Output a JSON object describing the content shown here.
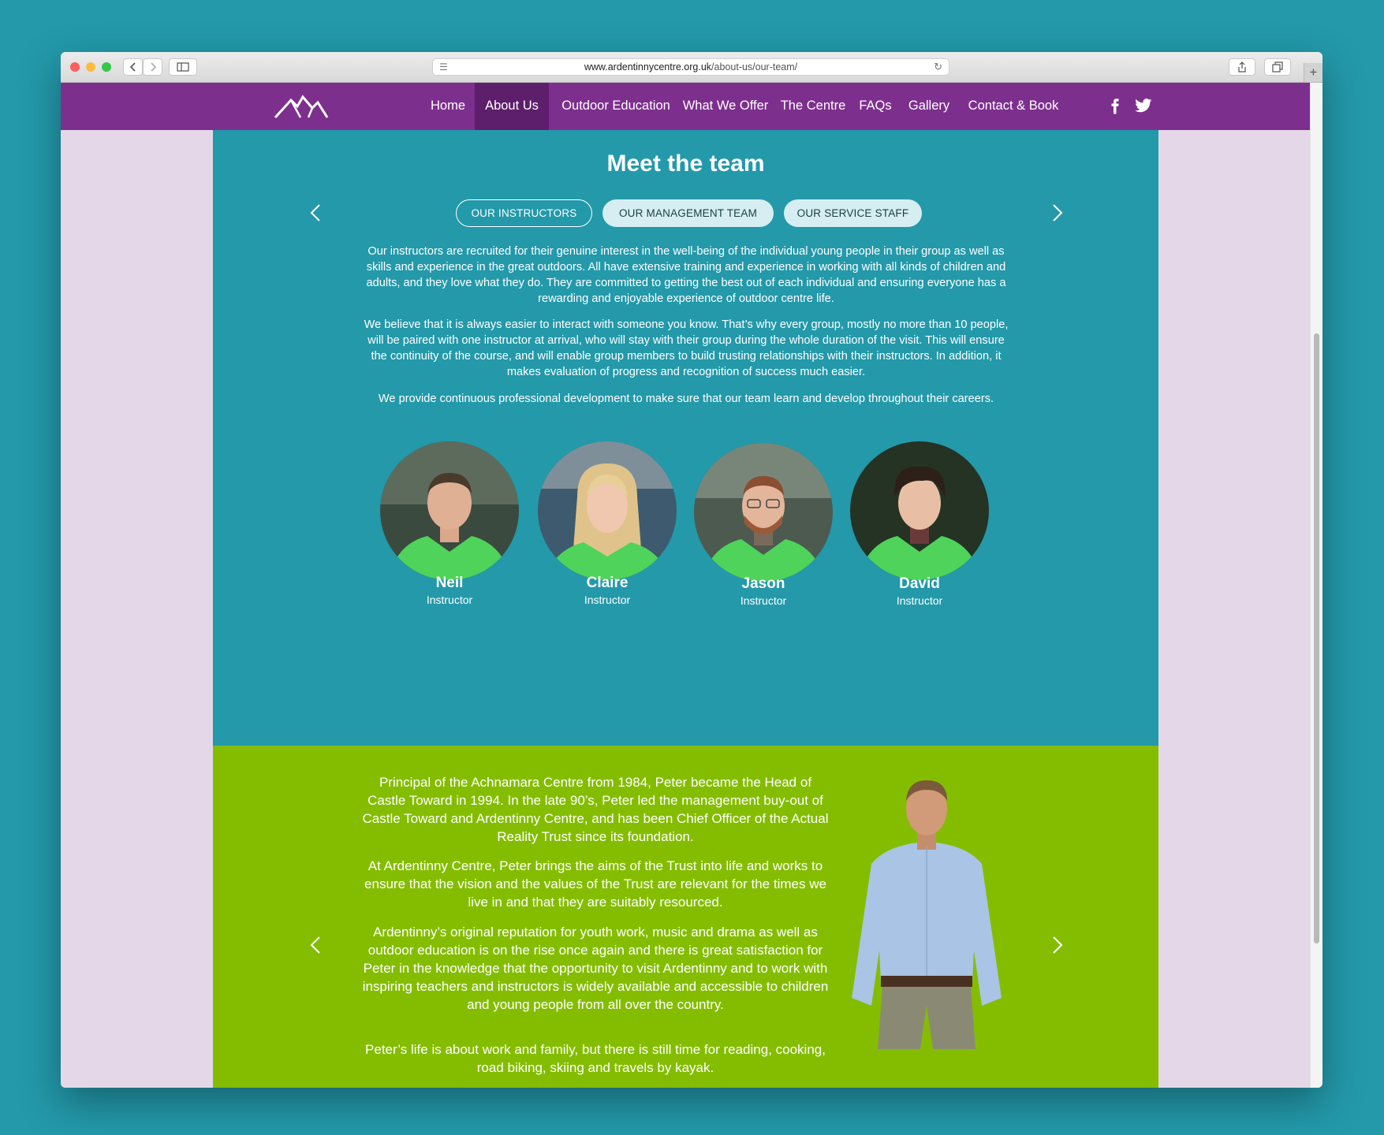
{
  "browser": {
    "url_domain": "www.ardentinnycentre.org.uk",
    "url_path": "/about-us/our-team/"
  },
  "nav": {
    "items": [
      "Home",
      "About Us",
      "Outdoor Education",
      "What We Offer",
      "The Centre",
      "FAQs",
      "Gallery",
      "Contact & Book"
    ],
    "active": "About Us",
    "social": [
      "facebook-icon",
      "twitter-icon"
    ]
  },
  "team": {
    "title": "Meet the team",
    "tabs": [
      "OUR INSTRUCTORS",
      "OUR MANAGEMENT TEAM",
      "OUR SERVICE STAFF"
    ],
    "paragraphs": [
      "Our instructors are recruited for their genuine interest in the well-being of the individual young people in their group as well as skills and experience in the great outdoors. All have extensive training and experience in working with all kinds of children and adults, and they love what they do. They are committed to getting the best out of each individual and ensuring everyone has a rewarding and enjoyable experience of outdoor centre life.",
      "We believe that it is always easier to interact with someone you know. That’s why every group, mostly no more than 10 people, will be paired with one instructor at arrival, who will stay with their group during the whole duration of the visit. This will ensure the continuity of the course, and will enable group members to build trusting relationships with their instructors. In addition, it makes evaluation of progress and recognition of success much easier.",
      "We provide continuous professional development to make sure that our team learn and develop throughout their careers."
    ],
    "members": [
      {
        "name": "Neil",
        "role": "Instructor"
      },
      {
        "name": "Claire",
        "role": "Instructor"
      },
      {
        "name": "Jason",
        "role": "Instructor"
      },
      {
        "name": "David",
        "role": "Instructor"
      }
    ]
  },
  "profile": {
    "paragraphs": [
      "Principal of the Achnamara Centre from 1984, Peter became the Head of Castle Toward in 1994. In the late 90’s, Peter led the management buy-out of Castle Toward and Ardentinny Centre, and has been Chief Officer of the Actual Reality Trust since its foundation.",
      "At Ardentinny Centre, Peter brings the aims of the Trust into life and works to ensure that the vision and the values of the Trust are relevant for the times we live in and that they are suitably resourced.",
      "Ardentinny’s original reputation for youth work, music and drama as well as outdoor education is on the rise once again and there is great satisfaction for Peter in the knowledge that the opportunity to visit Ardentinny and to work with inspiring teachers and instructors is widely available and accessible to children and young people from all over the country.",
      "Peter’s life is about work and family, but there is still time for reading, cooking, road biking, skiing and travels by kayak."
    ]
  },
  "colors": {
    "nav": "#7d2f8d",
    "teal": "#2399aa",
    "green": "#84bd00",
    "side": "#e3d7e8"
  }
}
